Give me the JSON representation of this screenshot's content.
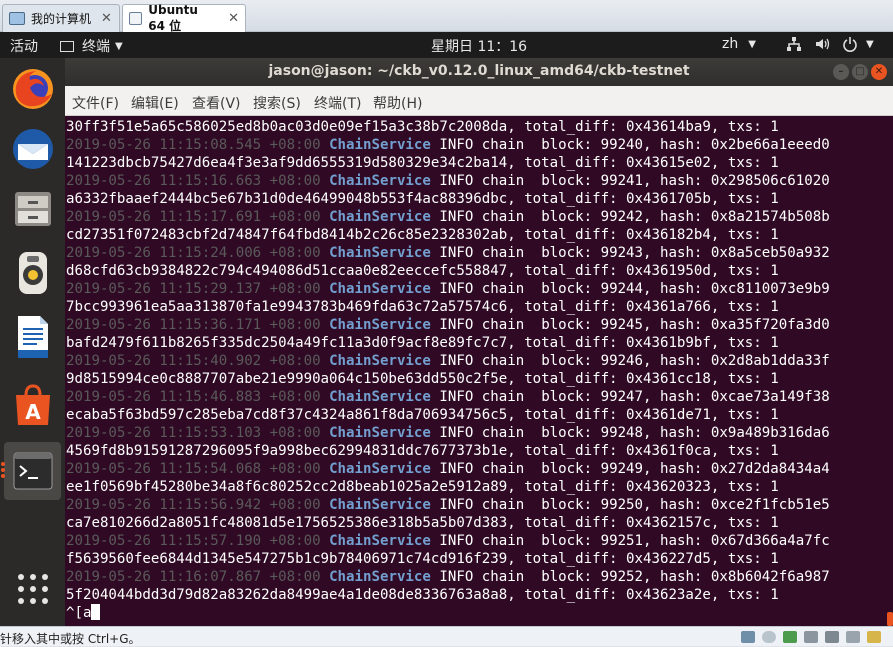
{
  "vm_tabs": [
    {
      "label": "我的计算机",
      "icon": "computer-icon"
    },
    {
      "label": "Ubuntu 64 位",
      "icon": "vm-icon",
      "close": "✕"
    }
  ],
  "vm_tab_close_first": "✕",
  "top_panel": {
    "activities": "活动",
    "app_menu": "终端",
    "clock": "星期日 11：16",
    "input_method": "zh"
  },
  "terminal": {
    "title": "jason@jason: ~/ckb_v0.12.0_linux_amd64/ckb-testnet",
    "menu": [
      "文件(F)",
      "编辑(E)",
      "查看(V)",
      "搜索(S)",
      "终端(T)",
      "帮助(H)"
    ],
    "first_line": "30ff3f51e5a65c586025ed8b0ac03d0e09ef15a3c38b7c2008da, total_diff: 0x43614ba9, txs: 1",
    "log_entries": [
      {
        "ts": "2019-05-26 11:15:08.545 +08:00",
        "svc": "ChainService",
        "rest": " INFO chain  block: 99240, hash: 0x2be66a1eeed0",
        "cont": "141223dbcb75427d6ea4f3e3af9dd6555319d580329e34c2ba14, total_diff: 0x43615e02, txs: 1"
      },
      {
        "ts": "2019-05-26 11:15:16.663 +08:00",
        "svc": "ChainService",
        "rest": " INFO chain  block: 99241, hash: 0x298506c61020",
        "cont": "a6332fbaaef2444bc5e67b31d0de46499048b553f4ac88396dbc, total_diff: 0x4361705b, txs: 1"
      },
      {
        "ts": "2019-05-26 11:15:17.691 +08:00",
        "svc": "ChainService",
        "rest": " INFO chain  block: 99242, hash: 0x8a21574b508b",
        "cont": "cd27351f072483cbf2d74847f64fbd8414b2c26c85e2328302ab, total_diff: 0x436182b4, txs: 1"
      },
      {
        "ts": "2019-05-26 11:15:24.006 +08:00",
        "svc": "ChainService",
        "rest": " INFO chain  block: 99243, hash: 0x8a5ceb50a932",
        "cont": "d68cfd63cb9384822c794c494086d51ccaa0e82eeccefc558847, total_diff: 0x4361950d, txs: 1"
      },
      {
        "ts": "2019-05-26 11:15:29.137 +08:00",
        "svc": "ChainService",
        "rest": " INFO chain  block: 99244, hash: 0xc8110073e9b9",
        "cont": "7bcc993961ea5aa313870fa1e9943783b469fda63c72a57574c6, total_diff: 0x4361a766, txs: 1"
      },
      {
        "ts": "2019-05-26 11:15:36.171 +08:00",
        "svc": "ChainService",
        "rest": " INFO chain  block: 99245, hash: 0xa35f720fa3d0",
        "cont": "bafd2479f611b8265f335dc2504a49fc11a3d0f9acf8e89fc7c7, total_diff: 0x4361b9bf, txs: 1"
      },
      {
        "ts": "2019-05-26 11:15:40.902 +08:00",
        "svc": "ChainService",
        "rest": " INFO chain  block: 99246, hash: 0x2d8ab1dda33f",
        "cont": "9d8515994ce0c8887707abe21e9990a064c150be63dd550c2f5e, total_diff: 0x4361cc18, txs: 1"
      },
      {
        "ts": "2019-05-26 11:15:46.883 +08:00",
        "svc": "ChainService",
        "rest": " INFO chain  block: 99247, hash: 0xcae73a149f38",
        "cont": "ecaba5f63bd597c285eba7cd8f37c4324a861f8da706934756c5, total_diff: 0x4361de71, txs: 1"
      },
      {
        "ts": "2019-05-26 11:15:53.103 +08:00",
        "svc": "ChainService",
        "rest": " INFO chain  block: 99248, hash: 0x9a489b316da6",
        "cont": "4569fd8b91591287296095f9a998bec62994831ddc7677373b1e, total_diff: 0x4361f0ca, txs: 1"
      },
      {
        "ts": "2019-05-26 11:15:54.068 +08:00",
        "svc": "ChainService",
        "rest": " INFO chain  block: 99249, hash: 0x27d2da8434a4",
        "cont": "ee1f0569bf45280be34a8f6c80252cc2d8beab1025a2e5912a89, total_diff: 0x43620323, txs: 1"
      },
      {
        "ts": "2019-05-26 11:15:56.942 +08:00",
        "svc": "ChainService",
        "rest": " INFO chain  block: 99250, hash: 0xce2f1fcb51e5",
        "cont": "ca7e810266d2a8051fc48081d5e1756525386e318b5a5b07d383, total_diff: 0x4362157c, txs: 1"
      },
      {
        "ts": "2019-05-26 11:15:57.190 +08:00",
        "svc": "ChainService",
        "rest": " INFO chain  block: 99251, hash: 0x67d366a4a7fc",
        "cont": "f5639560fee6844d1345e547275b1c9b78406971c74cd916f239, total_diff: 0x436227d5, txs: 1"
      },
      {
        "ts": "2019-05-26 11:16:07.867 +08:00",
        "svc": "ChainService",
        "rest": " INFO chain  block: 99252, hash: 0x8b6042f6a987",
        "cont": "5f204044bdd3d79d82a83262da8499ae4a1de08de8336763a8a8, total_diff: 0x43623a2e, txs: 1"
      }
    ],
    "prompt_line": "^[a"
  },
  "status_bar": {
    "text": "针移入其中或按 Ctrl+G。"
  },
  "colors": {
    "terminal_bg": "#300a24",
    "timestamp": "#5a5a5a",
    "service": "#729fcf",
    "accent": "#e95420"
  }
}
